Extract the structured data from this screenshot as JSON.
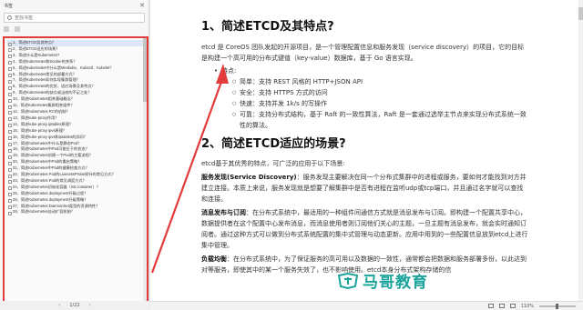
{
  "sidebar": {
    "title": "书签",
    "close_glyph": "✕",
    "search_placeholder": "查找书签",
    "toc": [
      "1、简述ETCD及其特点？",
      "2、简述ETCD适应的场景？",
      "3、简述什么是Kubernetes?",
      "4、简述Kubernetes和Docker的关系？",
      "5、简述Kubernetes中什么是Minikube、Kubectl、Kubelet？",
      "6、简述Kubernetes常见的部署方式？",
      "7、简述Kubernetes如何实现集群管理？",
      "8、简述Kubernetes的优势、适应场景及其特点？",
      "9、简述Kubernetes的缺点或当前的不足之处？",
      "10、简述Kubernetes相关基础概念？",
      "11、简述Kubernetes集群相关组件？",
      "12、简述Kubernetes RC的机制？",
      "13、简述kube-proxy作用？",
      "14、简述kube-proxy iptables原理？",
      "15、简述kube-proxy ipvs原理？",
      "16、简述kube-proxy ipvs和iptables的异同？",
      "17、简述Kubernetes中什么是静态Pod？",
      "18、简述Kubernetes中Pod可能位于的状态？",
      "19、简述Kubernetes创建一个Pod的主要流程？",
      "20、简述Kubernetes中Pod的重启策略？",
      "21、简述Kubernetes中Pod的健康检查方式？",
      "22、简述Kubernetes Pod的LivenessProbe探针的常见方式？",
      "23、简述Kubernetes Pod的常见调度方式？",
      "24、简述Kubernetes初始化容器（init container）？",
      "25、简述Kubernetes deployment升级过程？",
      "26、简述Kubernetes deployment升级策略？",
      "27、简述Kubernetes DaemonSet类型的资源特性？",
      "28、简述Kubernetes自动扩容机制？"
    ],
    "page_indicator": "1/22"
  },
  "document": {
    "heading1": "1、简述ETCD及其特点?",
    "para1": "etcd 是 CoreOS 团队发起的开源项目，是一个管理配置信息和服务发现（service discovery）的项目，它的目标是构建一个高可用的分布式键值（key-value）数据库，基于 Go 语言实现。",
    "features_label": "特点:",
    "features": [
      "简单：支持 REST 风格的 HTTP+JSON API",
      "安全：支持 HTTPS 方式的访问",
      "快速：支持并发 1k/s 的写操作",
      "可靠：支持分布式结构，基于 Raft 的一致性算法，Raft 是一套通过选举主节点来实现分布式系统一致性的算法。"
    ],
    "heading2": "2、简述ETCD适应的场景?",
    "para2": "etcd基于其优秀的特点，可广泛的应用于以下场景:",
    "scene1_title": "服务发现(Service Discovery)",
    "scene1_text": "：服务发现主要解决在同一个分布式集群中的进程或服务，要如何才能找到对方并建立连接。本质上来说，服务发现就是想要了解集群中是否有进程在监听udp或tcp端口，并且通过名字就可以查找和连接。",
    "scene2_title": "消息发布与订阅",
    "scene2_text": "：在分布式系统中，最适用的一种组件间通信方式就是消息发布与订阅。即构建一个配置共享中心，数据提供者在这个配置中心发布消息，而消息使用者则订阅他们关心的主题，一旦主题有消息发布，就会实时通知订阅者。通过这种方式可以做到分布式系统配置的集中式管理与动态更新。应用中用到的一些配置信息放到etcd上进行集中管理。",
    "scene3_title": "负载均衡",
    "scene3_text": "：在分布式系统中，为了保证服务的高可用以及数据的一致性，通常都会把数据和服务部署多份，以此达到对等服务，即使其中的某一个服务失效了，也不影响使用。etcd本身分布式架构存储的信"
  },
  "watermark": {
    "text": "马哥教育"
  },
  "statusbar": {
    "zoom": "110%"
  },
  "colors": {
    "highlight_border": "#e23b3b",
    "watermark": "#1aa39a"
  }
}
